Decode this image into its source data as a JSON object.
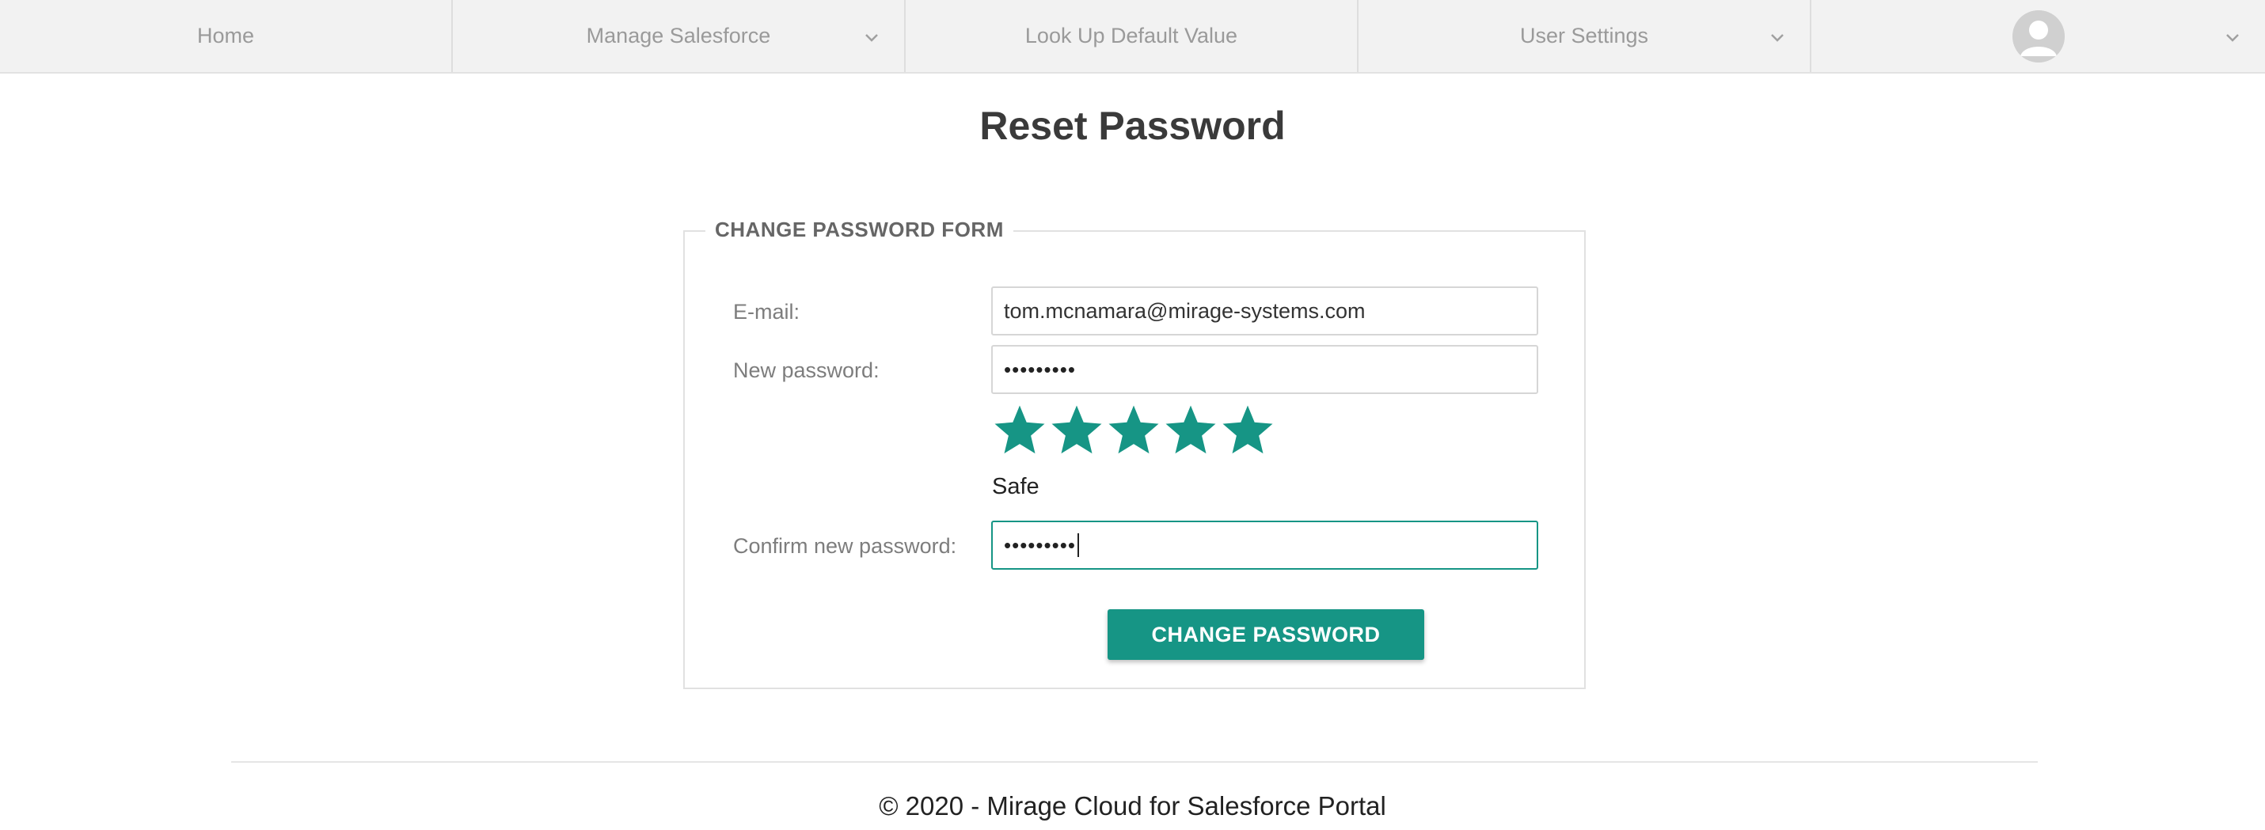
{
  "nav": {
    "items": [
      {
        "label": "Home",
        "dropdown": false
      },
      {
        "label": "Manage Salesforce",
        "dropdown": true
      },
      {
        "label": "Look Up Default Value",
        "dropdown": false
      },
      {
        "label": "User Settings",
        "dropdown": true
      }
    ],
    "profile_icon": "user-avatar-icon"
  },
  "page": {
    "title": "Reset Password"
  },
  "form": {
    "legend": "CHANGE PASSWORD FORM",
    "email_label": "E-mail:",
    "email_value": "tom.mcnamara@mirage-systems.com",
    "new_password_label": "New password:",
    "new_password_value": "•••••••••",
    "strength_stars": 5,
    "strength_max": 5,
    "strength_text": "Safe",
    "confirm_label": "Confirm new password:",
    "confirm_value": "•••••••••",
    "submit_label": "CHANGE PASSWORD"
  },
  "footer": {
    "text": "© 2020 - Mirage Cloud for Salesforce Portal"
  },
  "colors": {
    "accent": "#169585",
    "nav_bg": "#f2f2f2"
  }
}
